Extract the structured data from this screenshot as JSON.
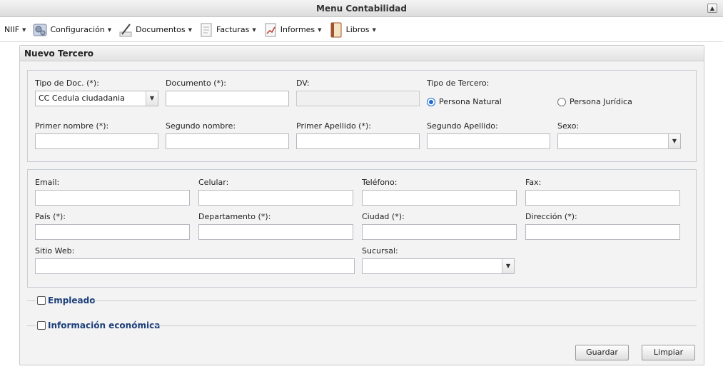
{
  "window": {
    "title": "Menu Contabilidad"
  },
  "menu": {
    "items": [
      {
        "label": "NIIF",
        "icon": "none"
      },
      {
        "label": "Configuración",
        "icon": "settings-icon"
      },
      {
        "label": "Documentos",
        "icon": "pen-icon"
      },
      {
        "label": "Facturas",
        "icon": "invoice-icon"
      },
      {
        "label": "Informes",
        "icon": "report-chart-icon"
      },
      {
        "label": "Libros",
        "icon": "book-icon"
      }
    ]
  },
  "panel": {
    "title": "Nuevo Tercero",
    "identity": {
      "tipo_doc_label": "Tipo de Doc. (*):",
      "tipo_doc_value": "CC Cedula ciudadania",
      "documento_label": "Documento (*):",
      "dv_label": "DV:",
      "tipo_tercero_label": "Tipo de Tercero:",
      "persona_natural_label": "Persona Natural",
      "persona_juridica_label": "Persona Jurídica",
      "persona_natural_checked": true,
      "primer_nombre_label": "Primer nombre (*):",
      "segundo_nombre_label": "Segundo nombre:",
      "primer_apellido_label": "Primer Apellido (*):",
      "segundo_apellido_label": "Segundo Apellido:",
      "sexo_label": "Sexo:"
    },
    "contact": {
      "email_label": "Email:",
      "celular_label": "Celular:",
      "telefono_label": "Teléfono:",
      "fax_label": "Fax:",
      "pais_label": "País (*):",
      "departamento_label": "Departamento (*):",
      "ciudad_label": "Ciudad (*):",
      "direccion_label": "Dirección (*):",
      "sitio_web_label": "Sitio Web:",
      "sucursal_label": "Sucursal:"
    },
    "sections": {
      "empleado_label": "Empleado",
      "info_economica_label": "Información económica"
    },
    "buttons": {
      "guardar_label": "Guardar",
      "limpiar_label": "Limpiar"
    }
  }
}
